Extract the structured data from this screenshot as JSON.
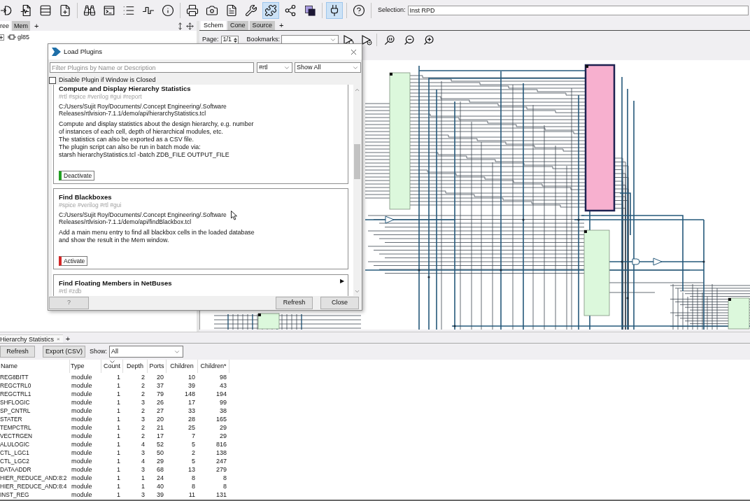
{
  "toolbar": {
    "buttons": [
      {
        "kind": "import",
        "on": false
      },
      {
        "kind": "waveform_file",
        "on": false
      },
      {
        "kind": "rows",
        "on": false
      },
      {
        "kind": "new_file",
        "on": false
      },
      {
        "kind": "separator"
      },
      {
        "kind": "find",
        "on": false
      },
      {
        "kind": "console",
        "on": false
      },
      {
        "kind": "list",
        "on": false
      },
      {
        "kind": "pulse",
        "on": false
      },
      {
        "kind": "info",
        "on": false
      },
      {
        "kind": "separator"
      },
      {
        "kind": "print",
        "on": false
      },
      {
        "kind": "snapshot",
        "on": false
      },
      {
        "kind": "report",
        "on": false
      },
      {
        "kind": "tools",
        "on": false
      },
      {
        "kind": "plugins",
        "on": true
      },
      {
        "kind": "network",
        "on": false
      },
      {
        "kind": "layers",
        "on": false
      },
      {
        "kind": "separator"
      },
      {
        "kind": "connect",
        "on": true
      },
      {
        "kind": "separator"
      },
      {
        "kind": "help",
        "on": false
      },
      {
        "kind": "separator"
      }
    ],
    "selection": {
      "label": "Selection:",
      "value": "Inst RPD"
    }
  },
  "left_panel": {
    "tabs": [
      {
        "label": "ree",
        "selected": true
      },
      {
        "label": "Mem",
        "selected": false
      }
    ],
    "add_tab": "+",
    "tree": [
      {
        "label": "gl85",
        "expanded": false
      }
    ]
  },
  "right_panel": {
    "tabs": [
      {
        "label": "Schem",
        "selected": true
      },
      {
        "label": "Cone",
        "selected": false
      },
      {
        "label": "Source",
        "selected": false
      }
    ],
    "add_tab": "+",
    "page": {
      "label": "Page:",
      "value": "1/1"
    },
    "bookmarks": {
      "label": "Bookmarks:"
    },
    "schematic": {
      "cells": [
        {
          "selected": false
        },
        {
          "selected": true
        },
        {
          "selected": false
        },
        {
          "selected": false
        },
        {
          "selected": false
        }
      ]
    }
  },
  "dialog": {
    "title": "Load Plugins",
    "filter": {
      "placeholder": "Filter Plugins by Name or Description"
    },
    "tag_filter": "#rtl",
    "show_filter": "Show All",
    "disable_checkbox": {
      "label": "Disable Plugin if Window is Closed",
      "checked": false
    },
    "plugins": [
      {
        "title": "Compute and Display Hierarchy Statistics",
        "tags": "#rtl #spice #verilog #gui #report",
        "path_lines": [
          "C:/Users/Sujit Roy/Documents/.Concept Engineering/.Software",
          "Releases/rtlvision-7.1.1/demo/api/hierarchyStatistics.tcl"
        ],
        "description_lines": [
          "Compute and display statistics about the design hierarchy, e.g. number",
          "of instances of each cell, depth of hierarchical modules, etc.",
          "The statistics can also be exported as a CSV file.",
          "The plugin script can also be run in batch mode via:",
          "starsh hierarchyStatistics.tcl -batch ZDB_FILE OUTPUT_FILE"
        ],
        "button": "Deactivate",
        "active": true
      },
      {
        "title": "Find Blackboxes",
        "tags": "#spice #verilog #rtl #gui",
        "path_lines": [
          "C:/Users/Sujit Roy/Documents/.Concept Engineering/.Software",
          "Releases/rtlvision-7.1.1/demo/api/findBlackbox.tcl"
        ],
        "description_lines": [
          "Add a main menu entry to find all blackbox cells in the loaded database",
          "and show the result in the Mem window."
        ],
        "button": "Activate",
        "active": false
      },
      {
        "title": "Find Floating Members in NetBuses",
        "tags": "#rtl #zdb",
        "marker": "▶"
      }
    ],
    "buttons": [
      "?",
      "Refresh",
      "Close"
    ]
  },
  "bottom_panel": {
    "tabs": [
      {
        "label": "Hierarchy Statistics",
        "close": "×"
      }
    ],
    "add_tab": "+",
    "buttons": [
      "Refresh",
      "Export (CSV)"
    ],
    "show": {
      "label": "Show:",
      "value": "All"
    },
    "table": {
      "columns": [
        {
          "label": "Name",
          "sorted": false
        },
        {
          "label": "Type",
          "sorted": false
        },
        {
          "label": "Count",
          "sorted": true
        },
        {
          "label": "Depth",
          "sorted": false
        },
        {
          "label": "Ports",
          "sorted": false
        },
        {
          "label": "Children",
          "sorted": false
        },
        {
          "label": "Children*",
          "sorted": false
        }
      ],
      "rows": [
        [
          "REG8BITT",
          "module",
          "1",
          "2",
          "20",
          "10",
          "98"
        ],
        [
          "REGCTRL0",
          "module",
          "1",
          "2",
          "37",
          "39",
          "43"
        ],
        [
          "REGCTRL1",
          "module",
          "1",
          "2",
          "79",
          "148",
          "194"
        ],
        [
          "SHFLOGIC",
          "module",
          "1",
          "3",
          "26",
          "17",
          "99"
        ],
        [
          "SP_CNTRL",
          "module",
          "1",
          "2",
          "27",
          "33",
          "38"
        ],
        [
          "STATER",
          "module",
          "1",
          "3",
          "20",
          "28",
          "165"
        ],
        [
          "TEMPCTRL",
          "module",
          "1",
          "2",
          "21",
          "25",
          "29"
        ],
        [
          "VECTRGEN",
          "module",
          "1",
          "2",
          "17",
          "7",
          "29"
        ],
        [
          "ALULOGIC",
          "module",
          "1",
          "4",
          "52",
          "5",
          "816"
        ],
        [
          "CTL_LGC1",
          "module",
          "1",
          "3",
          "50",
          "2",
          "138"
        ],
        [
          "CTL_LGC2",
          "module",
          "1",
          "4",
          "29",
          "5",
          "247"
        ],
        [
          "DATAADDR",
          "module",
          "1",
          "3",
          "68",
          "13",
          "279"
        ],
        [
          "HIER_REDUCE_AND:8:2",
          "module",
          "1",
          "1",
          "24",
          "8",
          "8"
        ],
        [
          "HIER_REDUCE_AND:8:4",
          "module",
          "1",
          "1",
          "40",
          "8",
          "8"
        ],
        [
          "INST_REG",
          "module",
          "1",
          "3",
          "39",
          "11",
          "131"
        ]
      ]
    }
  }
}
